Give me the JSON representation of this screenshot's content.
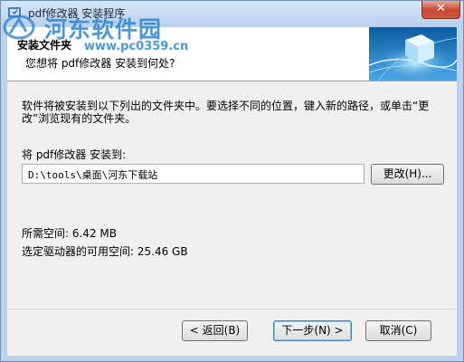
{
  "window": {
    "title": "pdf修改器 安装程序",
    "close_symbol": "✕"
  },
  "watermark": {
    "text": "河东软件园",
    "url": "www.pc0359.cn"
  },
  "header": {
    "title": "安装文件夹",
    "subtitle": "您想将 pdf修改器 安装到何处?"
  },
  "body": {
    "instructions": "软件将被安装到以下列出的文件夹中。要选择不同的位置，键入新的路径，或单击“更改”浏览现有的文件夹。",
    "install_to_label": "将 pdf修改器 安装到:",
    "install_path": "D:\\tools\\桌面\\河东下载站",
    "browse_button": "更改(H)...",
    "space_required": "所需空间: 6.42 MB",
    "space_available": "选定驱动器的可用空间: 25.46 GB"
  },
  "footer": {
    "back_button": "< 返回(B)",
    "next_button": "下一步(N) >",
    "cancel_button": "取消(C)"
  },
  "colors": {
    "title_bar": "#bcd4ef",
    "close_button": "#c7452f",
    "watermark": "#2f86cf",
    "header_graphic_sky": "#0b5da0"
  },
  "icons": {
    "app": "installer-icon",
    "header": "globe-cube-icon",
    "watermark": "watermark-logo"
  }
}
